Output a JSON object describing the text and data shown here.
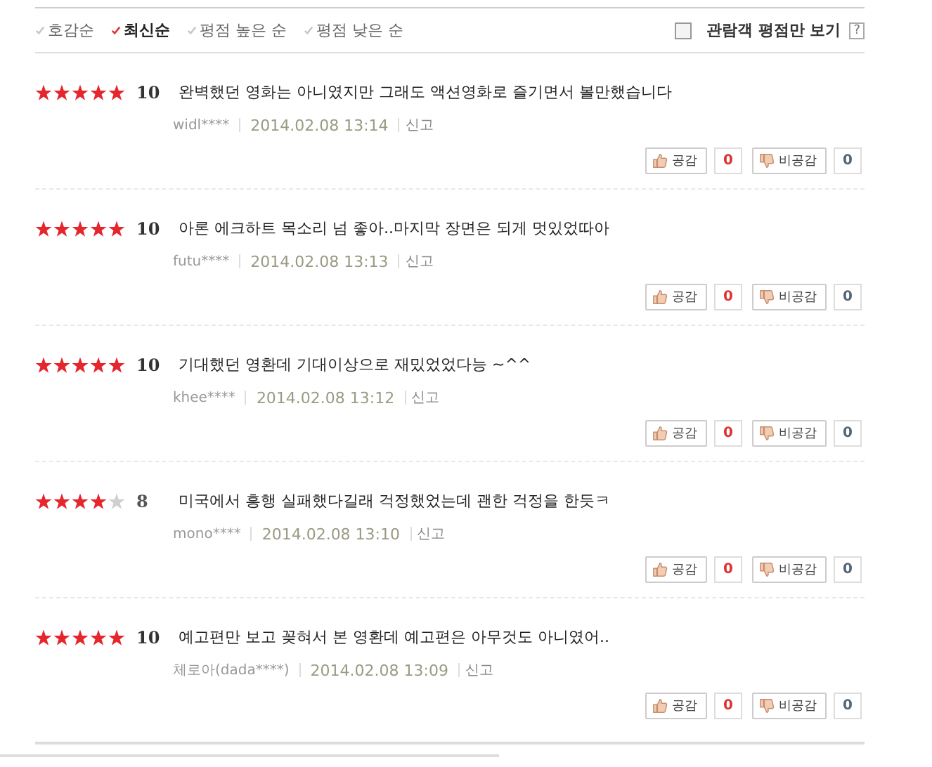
{
  "sort_options": [
    {
      "label": "호감순",
      "selected": false
    },
    {
      "label": "최신순",
      "selected": true
    },
    {
      "label": "평점 높은 순",
      "selected": false
    },
    {
      "label": "평점 낮은 순",
      "selected": false
    }
  ],
  "filter": {
    "label": "관람객 평점만 보기",
    "checked": false,
    "help": "?"
  },
  "reviews": [
    {
      "stars": 5,
      "score": "10",
      "text": "완벽했던 영화는 아니였지만 그래도 액션영화로 즐기면서 볼만했습니다",
      "user": "widl****",
      "date": "2014.02.08 13:14",
      "report": "신고",
      "like_label": "공감",
      "likes": "0",
      "dislike_label": "비공감",
      "dislikes": "0"
    },
    {
      "stars": 5,
      "score": "10",
      "text": "아론 에크하트 목소리 넘 좋아..마지막 장면은 되게 멋있었따아",
      "user": "futu****",
      "date": "2014.02.08 13:13",
      "report": "신고",
      "like_label": "공감",
      "likes": "0",
      "dislike_label": "비공감",
      "dislikes": "0"
    },
    {
      "stars": 5,
      "score": "10",
      "text": "기대했던 영환데 기대이상으로 재밌었었다능 ~^^",
      "user": "khee****",
      "date": "2014.02.08 13:12",
      "report": "신고",
      "like_label": "공감",
      "likes": "0",
      "dislike_label": "비공감",
      "dislikes": "0"
    },
    {
      "stars": 4,
      "score": "8",
      "text": "미국에서 흥행 실패했다길래 걱정했었는데 괜한 걱정을 한듯ㅋ",
      "user": "mono****",
      "date": "2014.02.08 13:10",
      "report": "신고",
      "like_label": "공감",
      "likes": "0",
      "dislike_label": "비공감",
      "dislikes": "0"
    },
    {
      "stars": 5,
      "score": "10",
      "text": "예고편만 보고 꽂혀서 본 영환데 예고편은 아무것도 아니였어..",
      "user": "체로아(dada****)",
      "date": "2014.02.08 13:09",
      "report": "신고",
      "like_label": "공감",
      "likes": "0",
      "dislike_label": "비공감",
      "dislikes": "0"
    }
  ]
}
